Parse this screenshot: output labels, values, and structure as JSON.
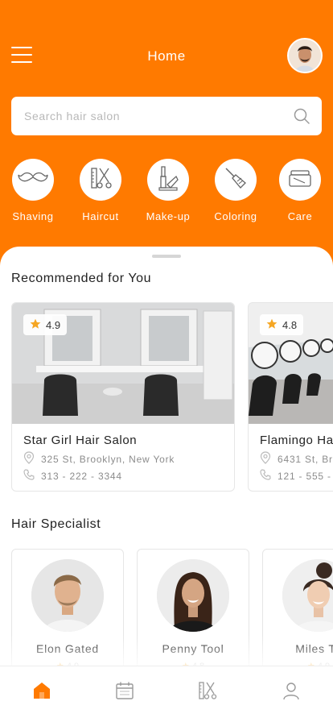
{
  "header": {
    "title": "Home",
    "search_placeholder": "Search hair salon",
    "accent": "#ff7a00"
  },
  "categories": [
    {
      "label": "Shaving",
      "icon": "mustache-icon"
    },
    {
      "label": "Haircut",
      "icon": "scissors-comb-icon"
    },
    {
      "label": "Make-up",
      "icon": "makeup-icon"
    },
    {
      "label": "Coloring",
      "icon": "paint-brush-icon"
    },
    {
      "label": "Care",
      "icon": "cream-jar-icon"
    }
  ],
  "recommended": {
    "title": "Recommended for You",
    "salons": [
      {
        "name": "Star Girl Hair Salon",
        "rating": "4.9",
        "address": "325 St, Brooklyn, New York",
        "phone": "313 - 222 - 3344"
      },
      {
        "name": "Flamingo Ha",
        "rating": "4.8",
        "address": "6431 St, Br",
        "phone": "121 - 555 -"
      }
    ]
  },
  "specialists": {
    "title": "Hair Specialist",
    "items": [
      {
        "name": "Elon Gated",
        "rating": "4.9"
      },
      {
        "name": "Penny Tool",
        "rating": "4.8"
      },
      {
        "name": "Miles To",
        "rating": "4.9"
      }
    ]
  },
  "nav": [
    "home-icon",
    "calendar-icon",
    "services-icon",
    "profile-icon"
  ]
}
